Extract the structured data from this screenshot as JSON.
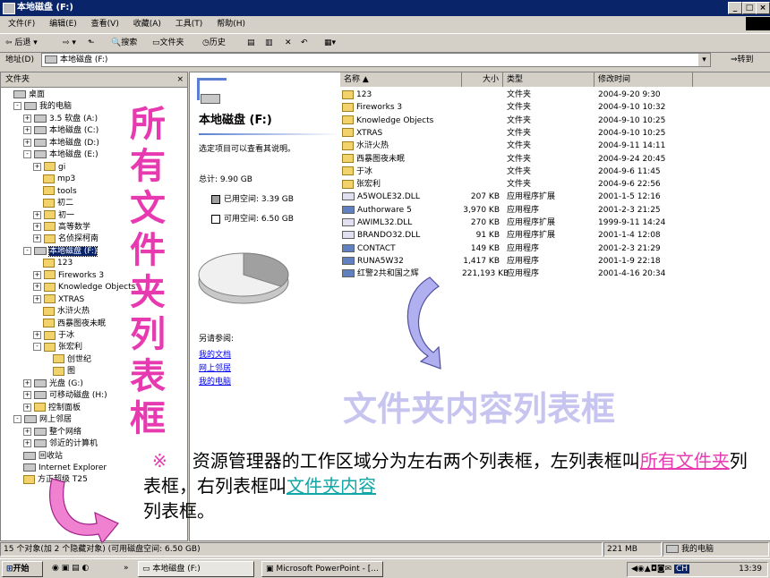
{
  "window": {
    "title": "本地磁盘 (F:)"
  },
  "menu": [
    "文件(F)",
    "编辑(E)",
    "查看(V)",
    "收藏(A)",
    "工具(T)",
    "帮助(H)"
  ],
  "toolbar": {
    "back": "后退",
    "search": "搜索",
    "folders": "文件夹",
    "history": "历史"
  },
  "address": {
    "label": "地址(D)",
    "value": "本地磁盘 (F:)",
    "go": "转到"
  },
  "left_pane": {
    "header": "文件夹",
    "tree": [
      {
        "label": "桌面",
        "level": 0,
        "type": "desktop"
      },
      {
        "label": "我的电脑",
        "level": 1,
        "type": "computer",
        "expander": "-"
      },
      {
        "label": "3.5 软盘 (A:)",
        "level": 2,
        "type": "drive",
        "expander": "+"
      },
      {
        "label": "本地磁盘 (C:)",
        "level": 2,
        "type": "drive",
        "expander": "+"
      },
      {
        "label": "本地磁盘 (D:)",
        "level": 2,
        "type": "drive",
        "expander": "+"
      },
      {
        "label": "本地磁盘 (E:)",
        "level": 2,
        "type": "drive",
        "expander": "-"
      },
      {
        "label": "gi",
        "level": 3,
        "type": "folder",
        "expander": "+"
      },
      {
        "label": "mp3",
        "level": 3,
        "type": "folder"
      },
      {
        "label": "tools",
        "level": 3,
        "type": "folder"
      },
      {
        "label": "初二",
        "level": 3,
        "type": "folder"
      },
      {
        "label": "初一",
        "level": 3,
        "type": "folder",
        "expander": "+"
      },
      {
        "label": "高等数学",
        "level": 3,
        "type": "folder",
        "expander": "+"
      },
      {
        "label": "名侦探柯南",
        "level": 3,
        "type": "folder",
        "expander": "+"
      },
      {
        "label": "本地磁盘 (F:)",
        "level": 2,
        "type": "drive",
        "expander": "-",
        "selected": true
      },
      {
        "label": "123",
        "level": 3,
        "type": "folder"
      },
      {
        "label": "Fireworks 3",
        "level": 3,
        "type": "folder",
        "expander": "+"
      },
      {
        "label": "Knowledge Objects",
        "level": 3,
        "type": "folder",
        "expander": "+"
      },
      {
        "label": "XTRAS",
        "level": 3,
        "type": "folder",
        "expander": "+"
      },
      {
        "label": "水浒火热",
        "level": 3,
        "type": "folder"
      },
      {
        "label": "西暴图夜未眠",
        "level": 3,
        "type": "folder"
      },
      {
        "label": "于冰",
        "level": 3,
        "type": "folder",
        "expander": "+"
      },
      {
        "label": "张宏利",
        "level": 3,
        "type": "folder",
        "expander": "-"
      },
      {
        "label": "创世纪",
        "level": 4,
        "type": "folder"
      },
      {
        "label": "图",
        "level": 4,
        "type": "folder"
      },
      {
        "label": "光盘 (G:)",
        "level": 2,
        "type": "drive",
        "expander": "+"
      },
      {
        "label": "可移动磁盘 (H:)",
        "level": 2,
        "type": "drive",
        "expander": "+"
      },
      {
        "label": "控制面板",
        "level": 2,
        "type": "folder",
        "expander": "+"
      },
      {
        "label": "网上邻居",
        "level": 1,
        "type": "network",
        "expander": "-"
      },
      {
        "label": "整个网络",
        "level": 2,
        "type": "network",
        "expander": "+"
      },
      {
        "label": "邻近的计算机",
        "level": 2,
        "type": "network",
        "expander": "+"
      },
      {
        "label": "回收站",
        "level": 1,
        "type": "recycle"
      },
      {
        "label": "Internet Explorer",
        "level": 1,
        "type": "ie"
      },
      {
        "label": "方正超级 T25",
        "level": 1,
        "type": "folder"
      }
    ]
  },
  "web_view": {
    "title": "本地磁盘 (F:)",
    "hint": "选定项目可以查看其说明。",
    "total": "总计: 9.90 GB",
    "used": "已用空间: 3.39 GB",
    "free": "可用空间: 6.50 GB",
    "used_fraction": 0.342,
    "see_also": "另请参阅:",
    "links": [
      "我的文档",
      "网上邻居",
      "我的电脑"
    ]
  },
  "columns": {
    "name": "名称",
    "size": "大小",
    "type": "类型",
    "modified": "修改时间"
  },
  "files": [
    {
      "name": "123",
      "size": "",
      "type": "文件夹",
      "modified": "2004-9-20 9:30",
      "icon": "folder"
    },
    {
      "name": "Fireworks 3",
      "size": "",
      "type": "文件夹",
      "modified": "2004-9-10 10:32",
      "icon": "folder"
    },
    {
      "name": "Knowledge Objects",
      "size": "",
      "type": "文件夹",
      "modified": "2004-9-10 10:25",
      "icon": "folder"
    },
    {
      "name": "XTRAS",
      "size": "",
      "type": "文件夹",
      "modified": "2004-9-10 10:25",
      "icon": "folder"
    },
    {
      "name": "水浒火热",
      "size": "",
      "type": "文件夹",
      "modified": "2004-9-11 14:11",
      "icon": "folder"
    },
    {
      "name": "西暴图夜未眠",
      "size": "",
      "type": "文件夹",
      "modified": "2004-9-24 20:45",
      "icon": "folder"
    },
    {
      "name": "于冰",
      "size": "",
      "type": "文件夹",
      "modified": "2004-9-6 11:45",
      "icon": "folder"
    },
    {
      "name": "张宏利",
      "size": "",
      "type": "文件夹",
      "modified": "2004-9-6 22:56",
      "icon": "folder"
    },
    {
      "name": "A5WOLE32.DLL",
      "size": "207 KB",
      "type": "应用程序扩展",
      "modified": "2001-1-5 12:16",
      "icon": "dll"
    },
    {
      "name": "Authorware 5",
      "size": "3,970 KB",
      "type": "应用程序",
      "modified": "2001-2-3 21:25",
      "icon": "app"
    },
    {
      "name": "AWIML32.DLL",
      "size": "270 KB",
      "type": "应用程序扩展",
      "modified": "1999-9-11 14:24",
      "icon": "dll"
    },
    {
      "name": "BRANDO32.DLL",
      "size": "91 KB",
      "type": "应用程序扩展",
      "modified": "2001-1-4 12:08",
      "icon": "dll"
    },
    {
      "name": "CONTACT",
      "size": "149 KB",
      "type": "应用程序",
      "modified": "2001-2-3 21:29",
      "icon": "app"
    },
    {
      "name": "RUNA5W32",
      "size": "1,417 KB",
      "type": "应用程序",
      "modified": "2001-1-9 22:18",
      "icon": "app"
    },
    {
      "name": "红警2共和国之辉",
      "size": "221,193 KB",
      "type": "应用程序",
      "modified": "2001-4-16 20:34",
      "icon": "app"
    }
  ],
  "overlay": {
    "left_label": "所有文件夹列表框",
    "right_label": "文件夹内容列表框",
    "caption_mark": "※",
    "caption_1": "资源管理器的工作区域分为左右两个列表框，左列表框叫",
    "caption_u1": "所有文件夹",
    "caption_2": "列表框，右列表框叫",
    "caption_u2": "文件夹内容",
    "caption_3": "列表框。"
  },
  "status": {
    "objects": "15 个对象(加 2 个隐藏对象) (可用磁盘空间: 6.50 GB)",
    "size": "221 MB",
    "zone": "我的电脑"
  },
  "taskbar": {
    "start": "开始",
    "task1": "本地磁盘 (F:)",
    "task2": "Microsoft PowerPoint - [...",
    "time": "13:39",
    "tray": "CH"
  }
}
